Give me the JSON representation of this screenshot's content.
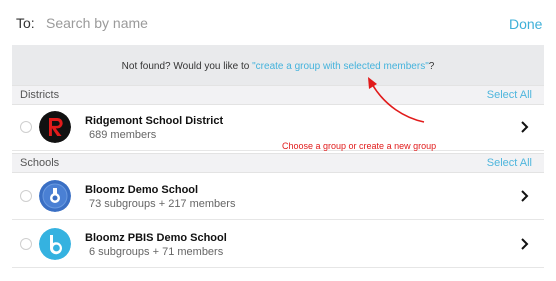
{
  "to_bar": {
    "label": "To:",
    "search_placeholder": "Search by name",
    "done_label": "Done"
  },
  "not_found": {
    "prefix": "Not found? Would you like to ",
    "link": "\"create a group with selected members\"",
    "suffix": "?"
  },
  "districts": {
    "title": "Districts",
    "select_all": "Select All",
    "items": [
      {
        "name": "Ridgemont School District",
        "sub": "689 members"
      }
    ]
  },
  "schools": {
    "title": "Schools",
    "select_all": "Select All",
    "items": [
      {
        "name": "Bloomz Demo School",
        "sub": "73 subgroups + 217 members"
      },
      {
        "name": "Bloomz PBIS Demo School",
        "sub": "6 subgroups + 71 members"
      }
    ]
  },
  "annotation": {
    "text": "Choose a group or create a new group"
  },
  "colors": {
    "accent": "#3fb0d8",
    "annotation": "#e11b1b",
    "notfound_bg": "#e9eaec"
  },
  "icons": {
    "district_avatar": "red-r-logo",
    "school_avatar_1": "bloomz-medal-logo",
    "school_avatar_2": "bloomz-b-logo",
    "row_action": "chevron-right-icon"
  }
}
